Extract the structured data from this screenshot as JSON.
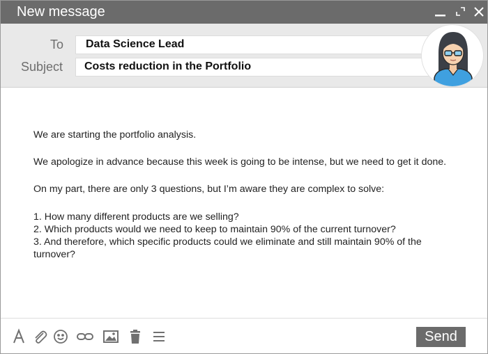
{
  "window": {
    "title": "New message"
  },
  "fields": {
    "to_label": "To",
    "to_value": "Data Science Lead",
    "subject_label": "Subject",
    "subject_value": "Costs reduction in the Portfolio"
  },
  "message": {
    "p1": "We are starting the portfolio analysis.",
    "p2": "We apologize in advance because this week is going to be intense, but we need to get it done.",
    "p3": "On my part, there are only 3 questions, but I’m aware they are complex to solve:",
    "q1": "1. How many different products are we selling?",
    "q2": "2. Which products would we need to keep to maintain 90% of the current turnover?",
    "q3": "3. And therefore, which specific products could we eliminate and still maintain 90% of the turnover?"
  },
  "toolbar": {
    "icons": [
      "format-text-icon",
      "attach-icon",
      "emoji-icon",
      "link-icon",
      "image-icon",
      "trash-icon",
      "more-options-icon"
    ],
    "send_label": "Send"
  },
  "colors": {
    "titlebar": "#6b6b6b",
    "header_bg": "#e9e9e9",
    "send_button": "#6b6b6b",
    "icon": "#707070"
  }
}
